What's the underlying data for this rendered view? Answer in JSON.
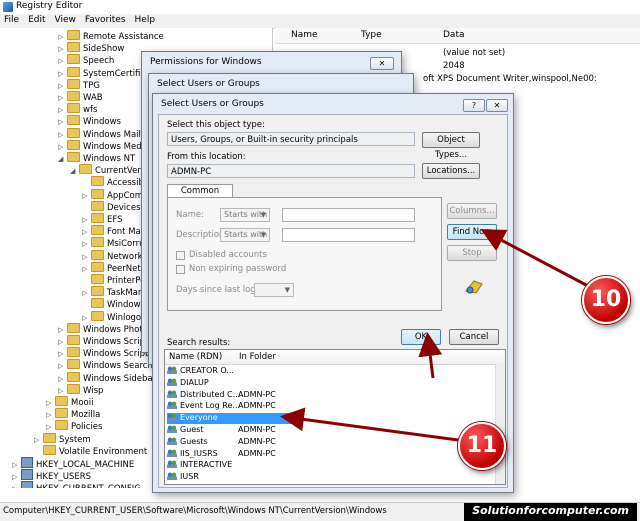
{
  "app": {
    "title": "Registry Editor",
    "menu": [
      "File",
      "Edit",
      "View",
      "Favorites",
      "Help"
    ]
  },
  "tree": {
    "items": [
      {
        "label": "Remote Assistance",
        "indent": 3,
        "twisty": "▷"
      },
      {
        "label": "SideShow",
        "indent": 3,
        "twisty": "▷"
      },
      {
        "label": "Speech",
        "indent": 3,
        "twisty": "▷"
      },
      {
        "label": "SystemCertificate",
        "indent": 3,
        "twisty": "▷"
      },
      {
        "label": "TPG",
        "indent": 3,
        "twisty": "▷"
      },
      {
        "label": "WAB",
        "indent": 3,
        "twisty": "▷"
      },
      {
        "label": "wfs",
        "indent": 3,
        "twisty": "▷"
      },
      {
        "label": "Windows",
        "indent": 3,
        "twisty": "▷"
      },
      {
        "label": "Windows Mail",
        "indent": 3,
        "twisty": "▷"
      },
      {
        "label": "Windows Media",
        "indent": 3,
        "twisty": "▷"
      },
      {
        "label": "Windows NT",
        "indent": 3,
        "twisty": "◢"
      },
      {
        "label": "CurrentVersion",
        "indent": 4,
        "twisty": "◢"
      },
      {
        "label": "Accessibi",
        "indent": 5,
        "twisty": ""
      },
      {
        "label": "AppComp",
        "indent": 5,
        "twisty": "▷"
      },
      {
        "label": "Devices",
        "indent": 5,
        "twisty": ""
      },
      {
        "label": "EFS",
        "indent": 5,
        "twisty": "▷"
      },
      {
        "label": "Font Man",
        "indent": 5,
        "twisty": "▷"
      },
      {
        "label": "MsiCorrup",
        "indent": 5,
        "twisty": "▷"
      },
      {
        "label": "Network",
        "indent": 5,
        "twisty": "▷"
      },
      {
        "label": "PeerNet",
        "indent": 5,
        "twisty": "▷"
      },
      {
        "label": "PrinterPo",
        "indent": 5,
        "twisty": ""
      },
      {
        "label": "TaskMana",
        "indent": 5,
        "twisty": "▷"
      },
      {
        "label": "Windows",
        "indent": 5,
        "twisty": ""
      },
      {
        "label": "Winlogo",
        "indent": 5,
        "twisty": "▷"
      },
      {
        "label": "Windows Photo V",
        "indent": 3,
        "twisty": "▷"
      },
      {
        "label": "Windows Script",
        "indent": 3,
        "twisty": "▷"
      },
      {
        "label": "Windows Script I",
        "indent": 3,
        "twisty": "▷"
      },
      {
        "label": "Windows Search",
        "indent": 3,
        "twisty": "▷"
      },
      {
        "label": "Windows Sidebar",
        "indent": 3,
        "twisty": "▷"
      },
      {
        "label": "Wisp",
        "indent": 3,
        "twisty": "▷"
      },
      {
        "label": "Mooii",
        "indent": 2,
        "twisty": "▷"
      },
      {
        "label": "Mozilla",
        "indent": 2,
        "twisty": "▷"
      },
      {
        "label": "Policies",
        "indent": 2,
        "twisty": "▷"
      },
      {
        "label": "System",
        "indent": 1,
        "twisty": "▷"
      },
      {
        "label": "Volatile Environment",
        "indent": 1,
        "twisty": ""
      },
      {
        "label": "HKEY_LOCAL_MACHINE",
        "indent": 0,
        "twisty": "▷",
        "hive": true
      },
      {
        "label": "HKEY_USERS",
        "indent": 0,
        "twisty": "▷",
        "hive": true
      },
      {
        "label": "HKEY_CURRENT_CONFIG",
        "indent": 0,
        "twisty": "▷",
        "hive": true
      }
    ]
  },
  "values": {
    "headers": {
      "name": "Name",
      "type": "Type",
      "data": "Data"
    },
    "rows": [
      "(value not set)",
      "2048",
      "oft XPS Document Writer,winspool,Ne00:"
    ]
  },
  "statusbar": {
    "path": "Computer\\HKEY_CURRENT_USER\\Software\\Microsoft\\Windows NT\\CurrentVersion\\Windows"
  },
  "watermark": "Solutionforcomputer.com",
  "dialogs": {
    "permissions_title": "Permissions for Windows",
    "select_back_title": "Select Users or Groups",
    "select": {
      "title": "Select Users or Groups",
      "object_type_label": "Select this object type:",
      "object_type_value": "Users, Groups, or Built-in security principals",
      "object_types_button": "Object Types...",
      "location_label": "From this location:",
      "location_value": "ADMN-PC",
      "locations_button": "Locations...",
      "tab_common_queries": "Common Queries",
      "name_label": "Name:",
      "description_label": "Description:",
      "starts_with": "Starts with",
      "disabled_accounts": "Disabled accounts",
      "non_expiring": "Non expiring password",
      "days_since_logon": "Days since last logon:",
      "columns_button": "Columns...",
      "find_now_button": "Find Now",
      "stop_button": "Stop",
      "search_results_label": "Search results:",
      "ok_button": "OK",
      "cancel_button": "Cancel",
      "help_button": "?",
      "close_button": "✕",
      "col_name": "Name (RDN)",
      "col_folder": "In Folder",
      "results": [
        {
          "name": "CREATOR O...",
          "folder": ""
        },
        {
          "name": "DIALUP",
          "folder": ""
        },
        {
          "name": "Distributed C...",
          "folder": "ADMN-PC"
        },
        {
          "name": "Event Log Re...",
          "folder": "ADMN-PC"
        },
        {
          "name": "Everyone",
          "folder": "",
          "selected": true
        },
        {
          "name": "Guest",
          "folder": "ADMN-PC"
        },
        {
          "name": "Guests",
          "folder": "ADMN-PC"
        },
        {
          "name": "IIS_IUSRS",
          "folder": "ADMN-PC"
        },
        {
          "name": "INTERACTIVE",
          "folder": ""
        },
        {
          "name": "IUSR",
          "folder": ""
        }
      ]
    }
  },
  "annotations": {
    "badge_10": "10",
    "badge_11": "11",
    "arrow_color": "#8b0000"
  }
}
